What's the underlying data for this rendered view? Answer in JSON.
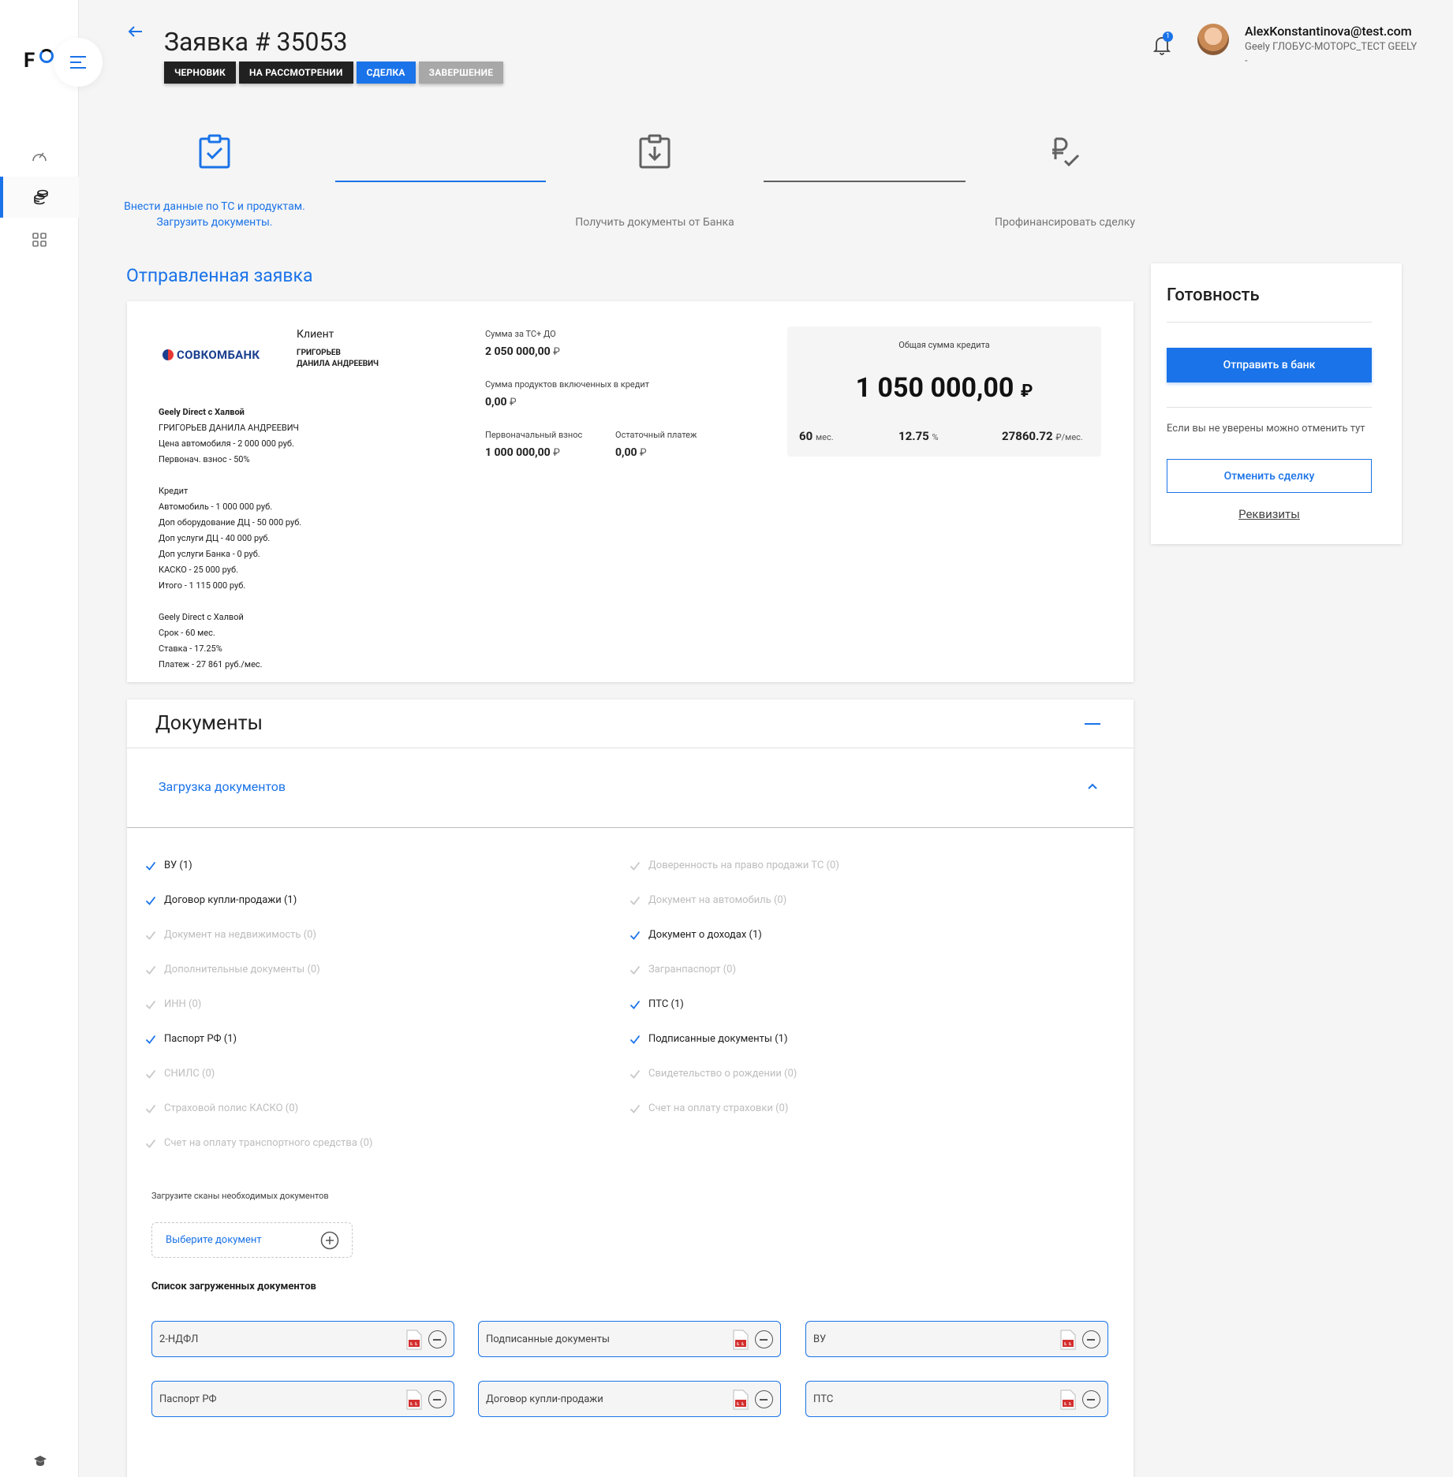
{
  "sidebar": {
    "logo_letter": "F",
    "items": [
      {
        "name": "dashboard-icon"
      },
      {
        "name": "coins-icon",
        "active": true
      },
      {
        "name": "grid-icon"
      }
    ]
  },
  "header": {
    "title": "Заявка # 35053",
    "statuses": [
      {
        "label": "ЧЕРНОВИК",
        "style": "dark"
      },
      {
        "label": "НА РАССМОТРЕНИИ",
        "style": "dark"
      },
      {
        "label": "СДЕЛКА",
        "style": "blue"
      },
      {
        "label": "ЗАВЕРШЕНИЕ",
        "style": "grey"
      }
    ],
    "notifications_count": "1",
    "user_email": "AlexKonstantinova@test.com",
    "user_org": "Geely ГЛОБУС-МОТОРС_ТЕСТ GEELY",
    "user_extra": "-"
  },
  "steps": [
    {
      "line1": "Внести данные по ТС и продуктам.",
      "line2": "Загрузить документы.",
      "icon": "clipboard-check-icon",
      "active": true
    },
    {
      "line1": "Получить документы от Банка",
      "line2": "",
      "icon": "clipboard-download-icon",
      "active": false
    },
    {
      "line1": "Профинансировать сделку",
      "line2": "",
      "icon": "ruble-check-icon",
      "active": false
    }
  ],
  "section_title": "Отправленная заявка",
  "application": {
    "bank_name": "СОВКОМБАНК",
    "client_label": "Клиент",
    "client_name_1": "ГРИГОРЬЕВ",
    "client_name_2": "ДАНИЛА АНДРЕЕВИЧ",
    "sum_ts_label": "Сумма за ТС+ ДО",
    "sum_ts_value": "2 050 000,00",
    "products_label": "Сумма продуктов включенных в кредит",
    "products_value": "0,00",
    "initial_label": "Первоначальный взнос",
    "initial_value": "1 000 000,00",
    "residual_label": "Остаточный платеж",
    "residual_value": "0,00",
    "currency": "₽",
    "details": [
      {
        "text": "Geely Direct с Халвой",
        "bold": true
      },
      {
        "text": "ГРИГОРЬЕВ ДАНИЛА АНДРЕЕВИЧ"
      },
      {
        "text": "Цена автомобиля - 2 000 000 руб."
      },
      {
        "text": "Первонач. взнос - 50%"
      },
      {
        "text": ""
      },
      {
        "text": "Кредит"
      },
      {
        "text": "Автомобиль - 1 000 000 руб."
      },
      {
        "text": "Доп оборудование ДЦ - 50 000 руб."
      },
      {
        "text": "Доп услуги ДЦ - 40 000 руб."
      },
      {
        "text": "Доп услуги Банка - 0 руб."
      },
      {
        "text": "КАСКО - 25 000 руб."
      },
      {
        "text": "Итого - 1 115 000 руб."
      },
      {
        "text": ""
      },
      {
        "text": "Geely Direct с Халвой"
      },
      {
        "text": "Срок - 60 мес."
      },
      {
        "text": "Ставка - 17.25%"
      },
      {
        "text": "Платеж - 27 861 руб./мес."
      }
    ],
    "credit_label": "Общая сумма кредита",
    "credit_amount": "1 050 000,00",
    "term_value": "60",
    "term_unit": "мес.",
    "rate_value": "12.75",
    "rate_unit": "%",
    "payment_value": "27860.72",
    "payment_unit": "₽/мес."
  },
  "ready": {
    "title": "Готовность",
    "send_button": "Отправить в банк",
    "hint": "Если вы не уверены можно отменить тут",
    "cancel_button": "Отменить сделку",
    "requisites_link": "Реквизиты"
  },
  "documents": {
    "title": "Документы",
    "subtitle": "Загрузка документов",
    "left": [
      {
        "label": "ВУ (1)",
        "done": true
      },
      {
        "label": "Договор купли-продажи (1)",
        "done": true
      },
      {
        "label": "Документ на недвижимость (0)",
        "done": false
      },
      {
        "label": "Дополнительные документы (0)",
        "done": false
      },
      {
        "label": "ИНН (0)",
        "done": false
      },
      {
        "label": "Паспорт РФ (1)",
        "done": true
      },
      {
        "label": "СНИЛС (0)",
        "done": false
      },
      {
        "label": "Страховой полис КАСКО (0)",
        "done": false
      },
      {
        "label": "Счет на оплату транспортного средства (0)",
        "done": false
      }
    ],
    "right": [
      {
        "label": "Доверенность на право продажи ТС (0)",
        "done": false
      },
      {
        "label": "Документ на автомобиль (0)",
        "done": false
      },
      {
        "label": "Документ о доходах (1)",
        "done": true
      },
      {
        "label": "Загранпаспорт (0)",
        "done": false
      },
      {
        "label": "ПТС (1)",
        "done": true
      },
      {
        "label": "Подписанные документы (1)",
        "done": true
      },
      {
        "label": "Свидетельство о рождении (0)",
        "done": false
      },
      {
        "label": "Счет на оплату страховки (0)",
        "done": false
      }
    ],
    "upload_hint": "Загрузите сканы необходимых документов",
    "select_placeholder": "Выберите документ",
    "list_title": "Список загруженных документов",
    "files": [
      "2-НДФЛ",
      "Подписанные документы",
      "ВУ",
      "Паспорт РФ",
      "Договор купли-продажи",
      "ПТС"
    ]
  },
  "colors": {
    "accent": "#1a73e8",
    "dark": "#212121",
    "muted": "#bdbdbd"
  }
}
